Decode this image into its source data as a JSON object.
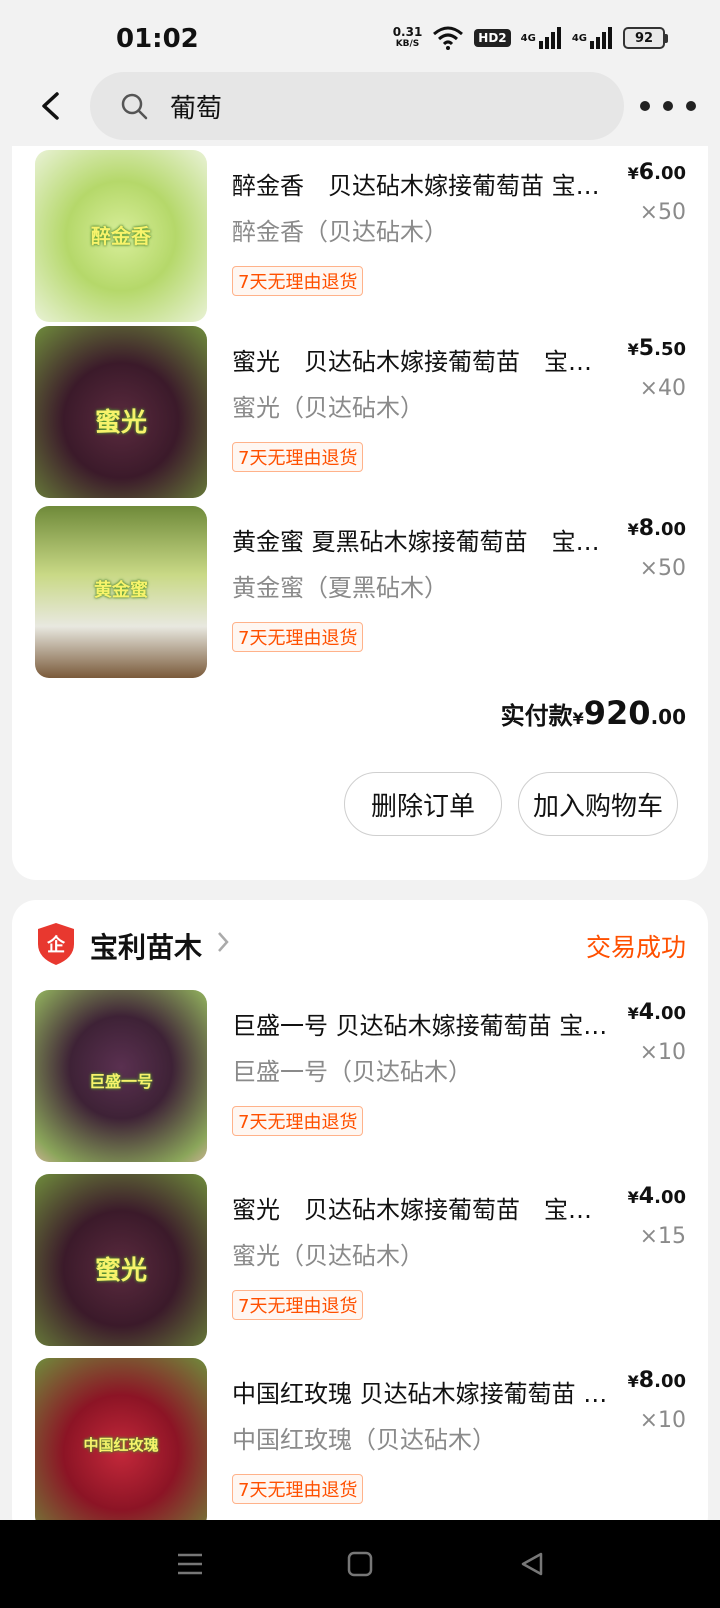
{
  "status_bar": {
    "time": "01:02",
    "net_speed_value": "0.31",
    "net_speed_unit": "KB/S",
    "hd": "HD2",
    "signal1": "4G",
    "signal2": "4G",
    "battery": "92"
  },
  "header": {
    "search_text": "葡萄"
  },
  "order1": {
    "items": [
      {
        "thumb_label": "醉金香",
        "title": "醉金香　贝达砧木嫁接葡萄苗 宝利苗木",
        "spec": "醉金香（贝达砧木）",
        "badge": "7天无理由退货",
        "price_yen": "¥",
        "price_int": "6",
        "price_dec": ".00",
        "qty": "×50"
      },
      {
        "thumb_label": "蜜光",
        "title": "蜜光　贝达砧木嫁接葡萄苗　宝利苗木",
        "spec": "蜜光（贝达砧木）",
        "badge": "7天无理由退货",
        "price_yen": "¥",
        "price_int": "5",
        "price_dec": ".50",
        "qty": "×40"
      },
      {
        "thumb_label": "黄金蜜",
        "title": "黄金蜜 夏黑砧木嫁接葡萄苗　宝利苗木",
        "spec": "黄金蜜（夏黑砧木）",
        "badge": "7天无理由退货",
        "price_yen": "¥",
        "price_int": "8",
        "price_dec": ".00",
        "qty": "×50"
      }
    ],
    "total_label": "实付款",
    "total_yen": "¥",
    "total_int": "920",
    "total_dec": ".00",
    "delete_btn": "删除订单",
    "cart_btn": "加入购物车"
  },
  "order2": {
    "shop_logo_text": "企",
    "shop_name": "宝利苗木",
    "status": "交易成功",
    "items": [
      {
        "thumb_label": "巨盛一号",
        "title": "巨盛一号 贝达砧木嫁接葡萄苗 宝利苗木",
        "spec": "巨盛一号（贝达砧木）",
        "badge": "7天无理由退货",
        "price_yen": "¥",
        "price_int": "4",
        "price_dec": ".00",
        "qty": "×10"
      },
      {
        "thumb_label": "蜜光",
        "title": "蜜光　贝达砧木嫁接葡萄苗　宝利苗木",
        "spec": "蜜光（贝达砧木）",
        "badge": "7天无理由退货",
        "price_yen": "¥",
        "price_int": "4",
        "price_dec": ".00",
        "qty": "×15"
      },
      {
        "thumb_label": "中国红玫瑰",
        "title": "中国红玫瑰 贝达砧木嫁接葡萄苗 宝利苗木",
        "spec": "中国红玫瑰（贝达砧木）",
        "badge": "7天无理由退货",
        "price_yen": "¥",
        "price_int": "8",
        "price_dec": ".00",
        "qty": "×10"
      }
    ]
  },
  "colors": {
    "accent": "#ff5000",
    "background": "#f2f2f2",
    "card": "#ffffff"
  }
}
